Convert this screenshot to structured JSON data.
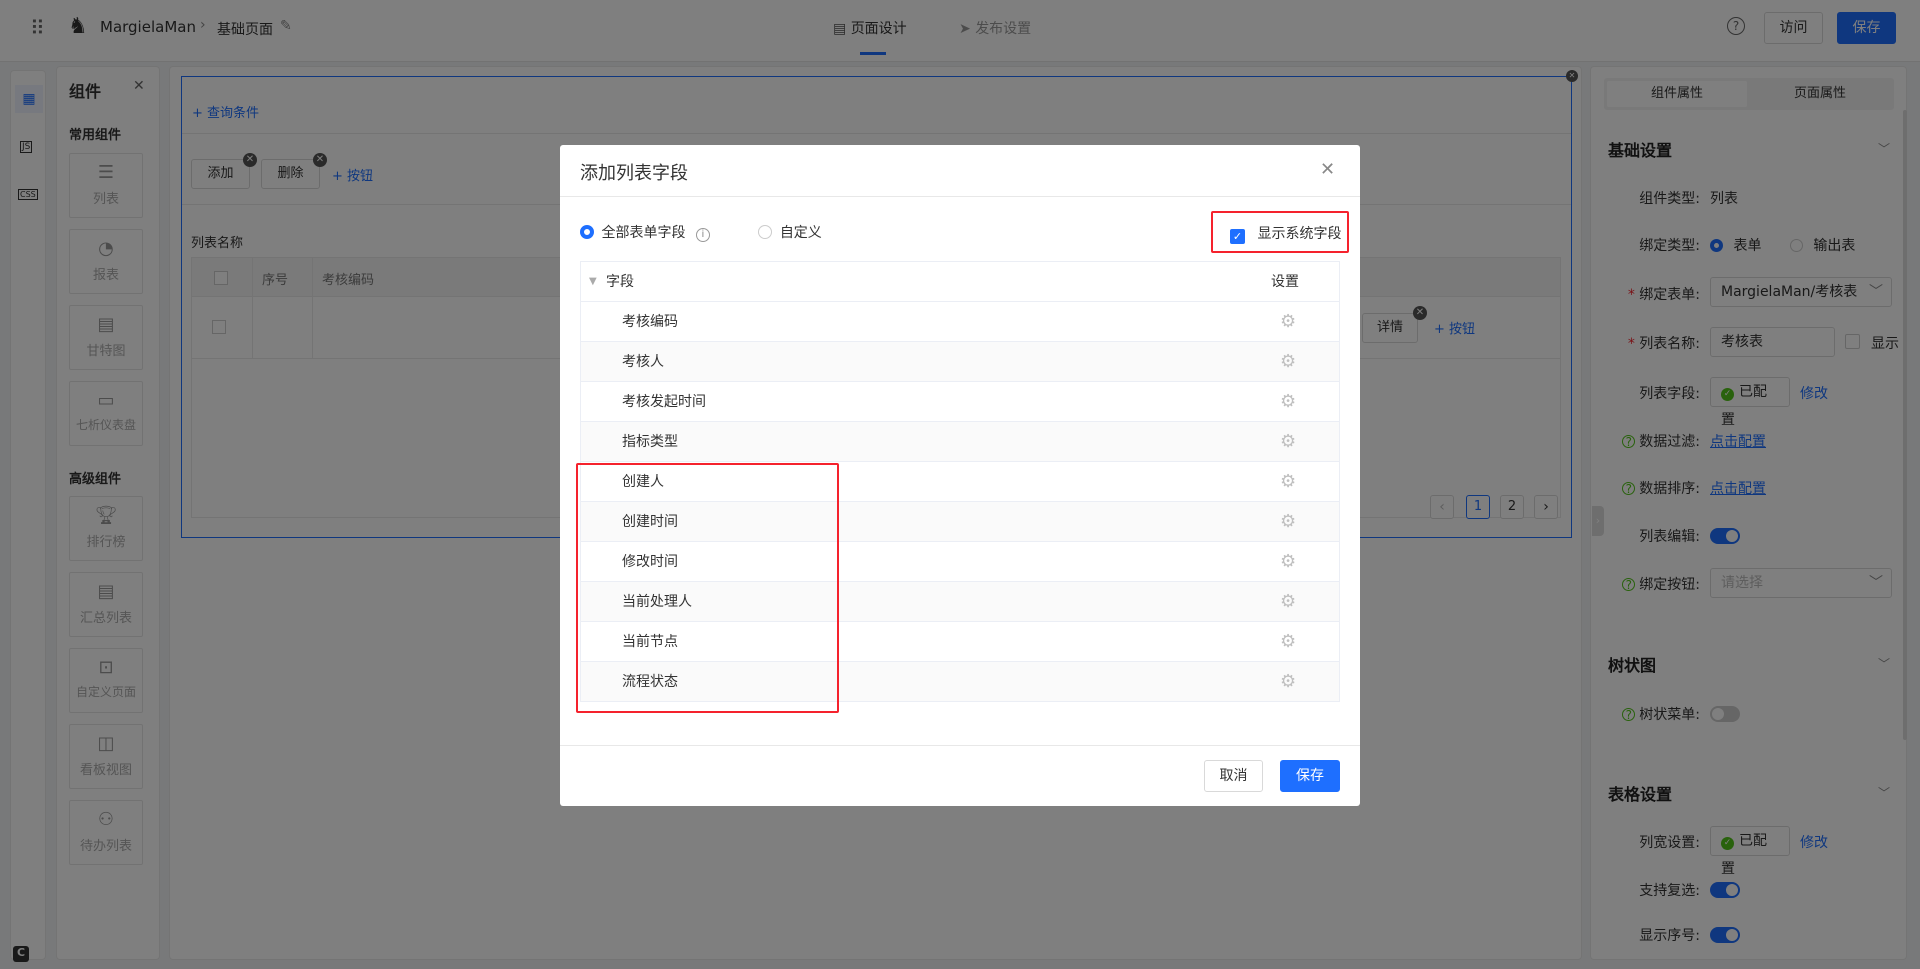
{
  "topbar": {
    "app_name": "MargielaMan",
    "breadcrumb": "基础页面",
    "tabs": [
      {
        "label": "页面设计",
        "active": true
      },
      {
        "label": "发布设置",
        "active": false
      }
    ],
    "visit_label": "访问",
    "save_label": "保存"
  },
  "left_rail": {
    "icons": [
      "grid-icon",
      "js-icon",
      "css-icon"
    ]
  },
  "components": {
    "title": "组件",
    "common_title": "常用组件",
    "common": [
      {
        "label": "列表",
        "icon": "list-icon"
      },
      {
        "label": "报表",
        "icon": "pie-chart-icon"
      },
      {
        "label": "甘特图",
        "icon": "gantt-icon"
      },
      {
        "label": "七析仪表盘",
        "icon": "dashboard-icon"
      }
    ],
    "advanced_title": "高级组件",
    "advanced": [
      {
        "label": "排行榜",
        "icon": "trophy-icon"
      },
      {
        "label": "汇总列表",
        "icon": "summary-list-icon"
      },
      {
        "label": "自定义页面",
        "icon": "terminal-icon"
      },
      {
        "label": "看板视图",
        "icon": "kanban-icon"
      },
      {
        "label": "待办列表",
        "icon": "org-tree-icon"
      }
    ]
  },
  "canvas": {
    "query_label": "+ 查询条件",
    "buttons": [
      "添加",
      "删除"
    ],
    "add_button_label": "+ 按钮",
    "list_name": "列表名称",
    "columns": [
      "序号",
      "考核编码"
    ],
    "row_button": "详情",
    "row_add_button": "+ 按钮",
    "pages": [
      "1",
      "2"
    ],
    "current_page": 1
  },
  "props": {
    "tabs": [
      "组件属性",
      "页面属性"
    ],
    "active_tab": "组件属性",
    "basic": {
      "title": "基础设置",
      "type_label": "组件类型:",
      "type_value": "列表",
      "bind_type_label": "绑定类型:",
      "bind_type_options": [
        "表单",
        "输出表"
      ],
      "bind_type_selected": "表单",
      "bind_form_label": "绑定表单:",
      "bind_form_value": "MargielaMan/考核表",
      "list_name_label": "列表名称:",
      "list_name_value": "考核表",
      "show_label": "显示",
      "show_checked": false,
      "fields_label": "列表字段:",
      "fields_status": "已配置",
      "modify": "修改",
      "filter_label": "数据过滤:",
      "filter_link": "点击配置",
      "sort_label": "数据排序:",
      "sort_link": "点击配置",
      "edit_label": "列表编辑:",
      "edit_on": true,
      "bind_btn_label": "绑定按钮:",
      "bind_btn_placeholder": "请选择"
    },
    "tree": {
      "title": "树状图",
      "menu_label": "树状菜单:",
      "menu_on": false
    },
    "table": {
      "title": "表格设置",
      "width_label": "列宽设置:",
      "width_status": "已配置",
      "modify": "修改",
      "multi_label": "支持复选:",
      "multi_on": true,
      "index_label": "显示序号:",
      "index_on": true
    }
  },
  "modal": {
    "title": "添加列表字段",
    "radio_all": "全部表单字段",
    "radio_custom": "自定义",
    "radio_selected": "全部表单字段",
    "show_system_label": "显示系统字段",
    "show_system_checked": true,
    "col_field": "字段",
    "col_settings": "设置",
    "fields": [
      "考核编码",
      "考核人",
      "考核发起时间",
      "指标类型",
      "创建人",
      "创建时间",
      "修改时间",
      "当前处理人",
      "当前节点",
      "流程状态"
    ],
    "cancel_label": "取消",
    "save_label": "保存"
  },
  "colors": {
    "primary": "#1e6fff",
    "highlight": "#f5222d",
    "success": "#52c41a"
  }
}
